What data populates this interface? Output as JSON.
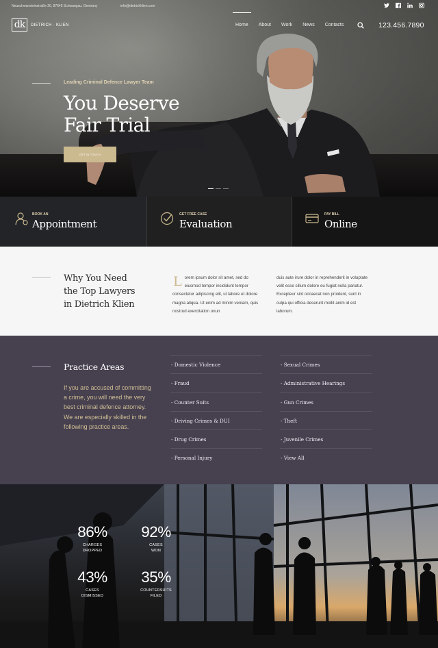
{
  "topbar": {
    "address": "Neuschwansteinstraße 20, 87645 Schwangau, Germany",
    "email": "info@dietrichklien.com",
    "socials": [
      "twitter-icon",
      "facebook-icon",
      "linkedin-icon",
      "instagram-icon"
    ]
  },
  "logo": {
    "mark": "dk",
    "name": "DIETRICH · KLIEN"
  },
  "nav": {
    "items": [
      "Home",
      "About",
      "Work",
      "News",
      "Contacts"
    ],
    "active": "Home"
  },
  "phone": "123.456.7890",
  "hero": {
    "kicker": "Leading Criminal Defence Lawyer Team",
    "title_line1": "You Deserve",
    "title_line2": "Fair Trial",
    "cta": "GET IN TOUCH",
    "slide_count": 3,
    "active_slide": 1
  },
  "services": [
    {
      "small": "BOOK AN",
      "big": "Appointment",
      "icon": "person-icon"
    },
    {
      "small": "GET FREE CASE",
      "big": "Evaluation",
      "icon": "check-circle-icon"
    },
    {
      "small": "PAY BILL",
      "big": "Online",
      "icon": "credit-card-icon"
    }
  ],
  "why": {
    "title_line1": "Why You Need",
    "title_line2": "the Top Lawyers",
    "title_line3": "in Dietrich  Klien",
    "dropcap": "L",
    "col1": "orem ipsum dolor sit amet, sed do eiusmod tempor incididunt tempor consectetur adipiscing elit,  ut labore et dolore magna aliqua. Ut enim ad minim veniam, quis nostrud exercitation onun",
    "col2": "duis aute irure dolor in reprehenderit in voluptate velit esse cillum dolore eu fugiat nulla pariatur. Excepteur sint occaecat  non proident, sunt in culpa qui officia deserunt mollit anim id est laborum."
  },
  "practice": {
    "title": "Practice Areas",
    "description": "If you are accused of committing a crime, you will need the very best criminal defence attorney. We are especially skilled in the following practice areas.",
    "col1": [
      "- Domestic Violence",
      "- Fraud",
      "- Counter Suits",
      "- Driving Crimes & DUI",
      "- Drug Crimes",
      "- Personal Injury"
    ],
    "col2": [
      "- Sexual Crimes",
      "- Administrative Hearings",
      "- Gun Crimes",
      "- Theft",
      "- Juvenile Crimes",
      "- View All"
    ]
  },
  "stats": [
    {
      "num": "86%",
      "label_line1": "CHARGES",
      "label_line2": "DROPPED"
    },
    {
      "num": "92%",
      "label_line1": "CASES",
      "label_line2": "WON"
    },
    {
      "num": "43%",
      "label_line1": "CASES",
      "label_line2": "DISMISSED"
    },
    {
      "num": "35%",
      "label_line1": "COUNTERSUITS",
      "label_line2": "FILED"
    }
  ],
  "colors": {
    "accent": "#cbb98f",
    "practice_bg": "#46404f",
    "dark": "#222428"
  }
}
